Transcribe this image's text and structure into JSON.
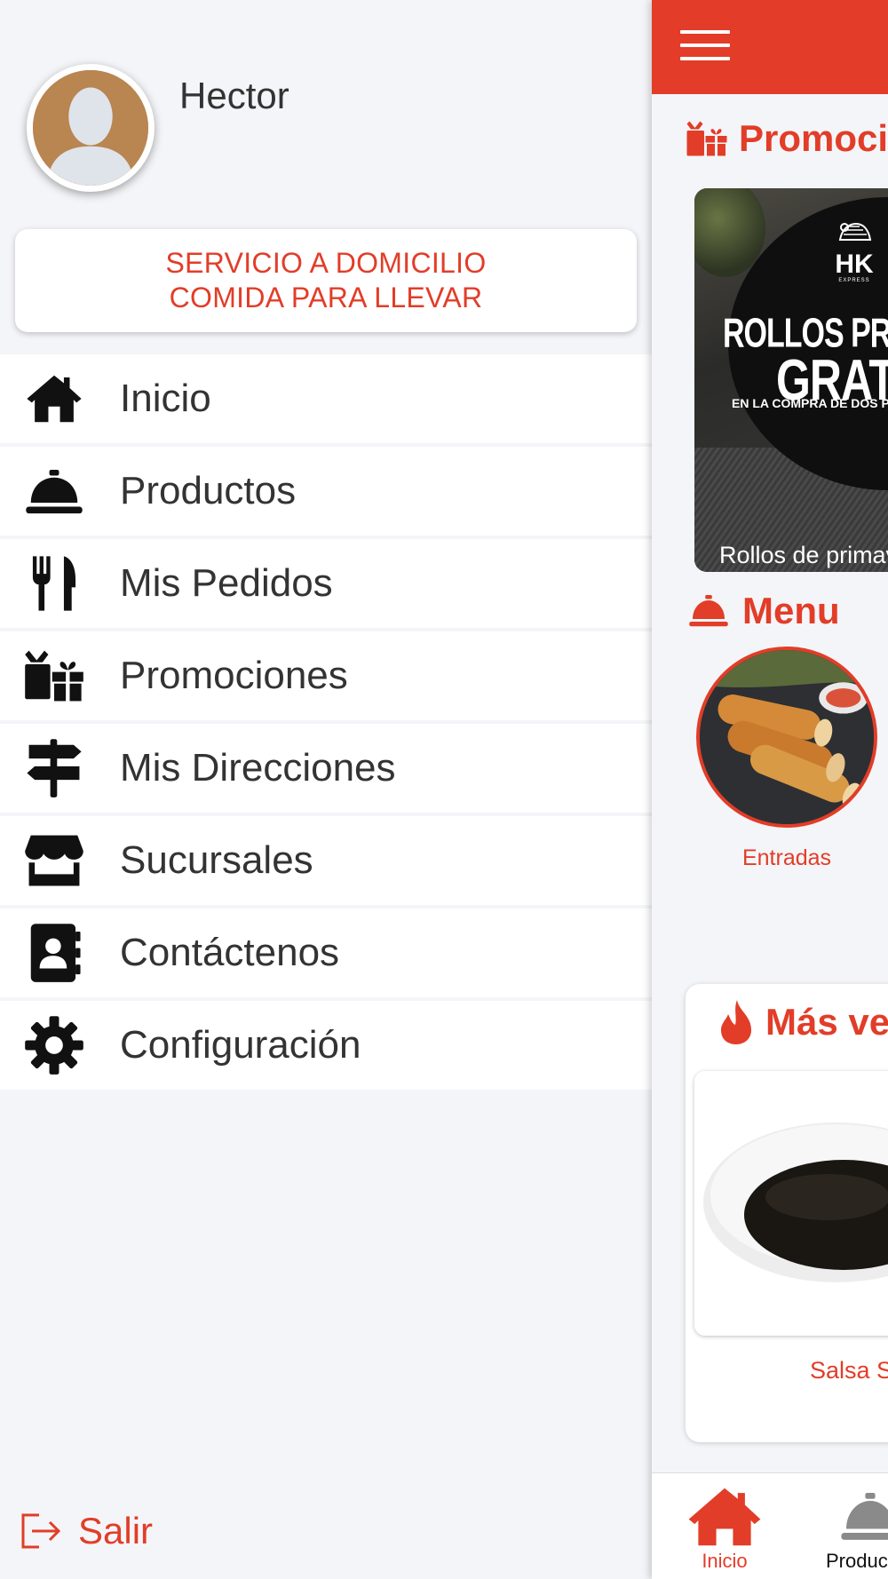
{
  "colors": {
    "accent": "#e33c28",
    "text": "#333333",
    "background": "#f4f5f8"
  },
  "user": {
    "name": "Hector"
  },
  "service_card": {
    "line1": "SERVICIO A DOMICILIO",
    "line2": "COMIDA PARA LLEVAR"
  },
  "menu": {
    "items": [
      {
        "label": "Inicio",
        "icon": "home-icon"
      },
      {
        "label": "Productos",
        "icon": "service-bell-icon"
      },
      {
        "label": "Mis Pedidos",
        "icon": "utensils-icon"
      },
      {
        "label": "Promociones",
        "icon": "gifts-icon"
      },
      {
        "label": "Mis Direcciones",
        "icon": "signpost-icon"
      },
      {
        "label": "Sucursales",
        "icon": "store-icon"
      },
      {
        "label": "Contáctenos",
        "icon": "address-book-icon"
      },
      {
        "label": "Configuración",
        "icon": "gear-icon"
      }
    ]
  },
  "logout": {
    "label": "Salir",
    "icon": "sign-out-icon"
  },
  "main": {
    "promotions_title": "Promociones",
    "promo": {
      "brand": "HK",
      "brand_sub": "EXPRESS",
      "headline1": "ROLLOS PRIMAVERA",
      "headline2": "GRATIS",
      "headline3": "EN LA COMPRA DE DOS PLATILLOS",
      "caption": "Rollos de primavera"
    },
    "menu_title": "Menu",
    "category": {
      "label": "Entradas"
    },
    "best_sellers_title": "Más vendidos",
    "best_seller": {
      "caption": "Salsa Soya"
    },
    "bottom_nav": [
      {
        "label": "Inicio",
        "icon": "home-icon",
        "active": true
      },
      {
        "label": "Productos",
        "icon": "service-bell-icon",
        "active": false
      }
    ]
  }
}
